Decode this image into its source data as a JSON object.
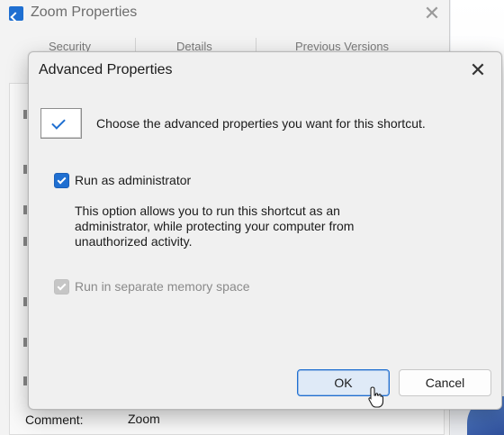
{
  "background_window": {
    "title": "Zoom Properties",
    "close_glyph": "✕",
    "tabs": [
      "Security",
      "Details",
      "Previous Versions"
    ],
    "comment_label": "Comment:",
    "comment_value": "Zoom"
  },
  "dialog": {
    "title": "Advanced Properties",
    "close_glyph": "✕",
    "intro_text": "Choose the advanced properties you want for this shortcut.",
    "run_as_admin": {
      "label": "Run as administrator",
      "checked": true,
      "description": "This option allows you to run this shortcut as an administrator, while protecting your computer from unauthorized activity."
    },
    "separate_memory": {
      "label": "Run in separate memory space",
      "checked": true,
      "enabled": false
    },
    "buttons": {
      "ok": "OK",
      "cancel": "Cancel"
    }
  },
  "colors": {
    "accent": "#1f6fd1",
    "dialog_bg": "#f0f0f0",
    "disabled_text": "#8a8a8a"
  },
  "icons": [
    "app-shortcut-icon",
    "close-icon",
    "checkmark-icon",
    "checkbox-checked-icon",
    "mouse-pointer-icon"
  ]
}
